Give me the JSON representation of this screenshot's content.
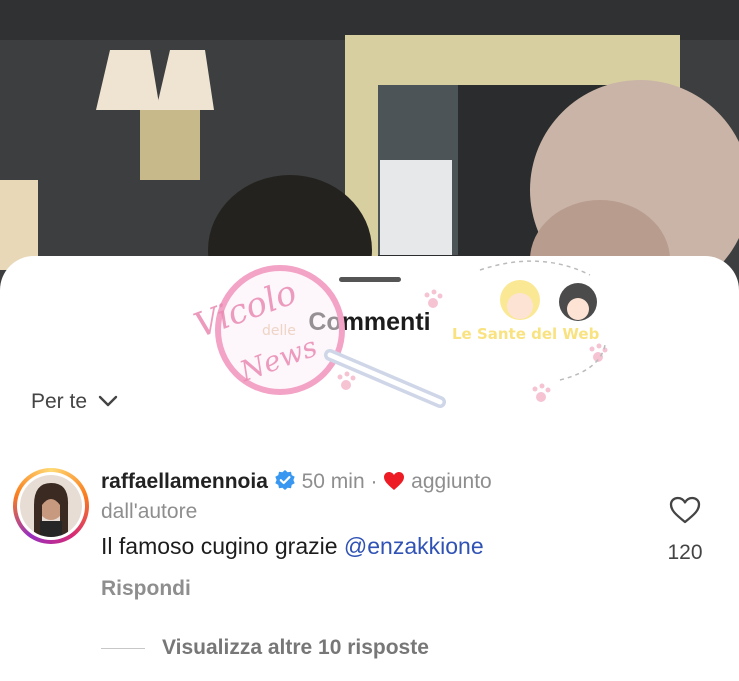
{
  "sheet": {
    "title": "Commenti"
  },
  "sort": {
    "label": "Per te",
    "icon": "chevron-down-icon"
  },
  "comment": {
    "username": "raffaellamennoia",
    "verified_icon": "verified-badge-icon",
    "time": "50 min",
    "separator": "·",
    "heart_icon": "red-heart-icon",
    "liked_by_author_text": "aggiunto dall'autore",
    "text": "Il famoso cugino grazie ",
    "mention": "@enzakkione",
    "reply_label": "Rispondi",
    "like_icon": "heart-outline-icon",
    "like_count": "120"
  },
  "replies": {
    "view_more_label": "Visualizza altre 10 risposte"
  },
  "watermark": {
    "text_primary": "Vicolo delle News",
    "text_secondary": "Le Sante del Web"
  },
  "colors": {
    "mention": "#2f52b4",
    "heart": "#ed1c24",
    "verified": "#3897f0",
    "background": "#ffffff"
  }
}
